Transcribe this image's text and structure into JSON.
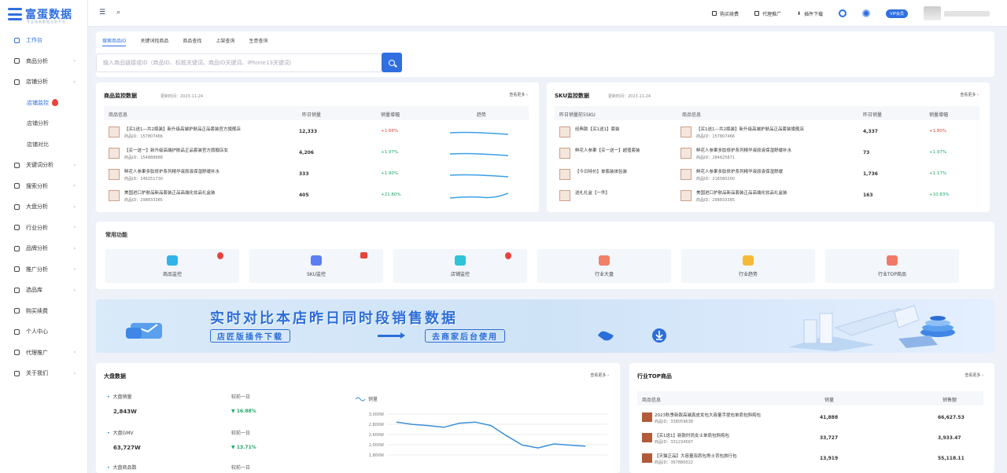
{
  "brand": {
    "name": "富蛋数据",
    "sub": "专业电商数据分析平台"
  },
  "sidebar": {
    "items": [
      {
        "label": "工作台",
        "active": true,
        "sub": false
      },
      {
        "label": "商品分析",
        "sub": false,
        "arrow": true
      },
      {
        "label": "店铺分析",
        "sub": false,
        "arrow": true
      },
      {
        "label": "店铺监控",
        "sub": true,
        "active": true,
        "hot": true
      },
      {
        "label": "店铺分析",
        "sub": true
      },
      {
        "label": "店铺对比",
        "sub": true
      },
      {
        "label": "关键词分析",
        "sub": false,
        "arrow": true
      },
      {
        "label": "搜索分析",
        "sub": false,
        "arrow": true
      },
      {
        "label": "大盘分析",
        "sub": false,
        "arrow": true
      },
      {
        "label": "行业分析",
        "sub": false,
        "arrow": true
      },
      {
        "label": "品牌分析",
        "sub": false,
        "arrow": true
      },
      {
        "label": "推广分析",
        "sub": false,
        "arrow": true
      },
      {
        "label": "选品库",
        "sub": false,
        "arrow": true
      },
      {
        "label": "购买续费",
        "sub": false
      },
      {
        "label": "个人中心",
        "sub": false
      },
      {
        "label": "代理推广",
        "sub": false,
        "arrow": true
      },
      {
        "label": "关于我们",
        "sub": false,
        "arrow": true
      }
    ]
  },
  "topbar": {
    "links": [
      "购买续费",
      "代理推广",
      "插件下载"
    ],
    "vip": "VIP会员"
  },
  "search": {
    "tabs": [
      "搜索商品ID",
      "关键词找商品",
      "商品查找",
      "上架查询",
      "生意查询"
    ],
    "placeholder": "输入商品链接或ID（商品ID、标题关键词、商品ID关键词、iPhone13关键词）"
  },
  "goods_monitor": {
    "title": "商品监控数据",
    "meta": "更新时间：2023-11-24",
    "more": "查看更多 ›",
    "headers": [
      "商品信息",
      "昨日销量",
      "销量增幅",
      "趋势"
    ],
    "rows": [
      {
        "name": "【买1送1—共2瓶装】新升级高端护肤品正品套装官方旗舰店",
        "id": "商品ID：157807466",
        "sales": "12,333",
        "pct": "+1.66%",
        "trend": "up"
      },
      {
        "name": "【买一送一】新升级高端护肤品正品套装官方旗舰店女",
        "id": "商品ID：154888888",
        "sales": "4,206",
        "pct": "+1.07%",
        "trend": "down"
      },
      {
        "name": "鲜花人参果多肽修护系列精华液原液保湿舒缓补水",
        "id": "商品ID：148251730",
        "sales": "333",
        "pct": "+1.90%",
        "trend": "down"
      },
      {
        "name": "美国进口护肤品新品套装正品高端化妆品礼盒装",
        "id": "商品ID：298833385",
        "sales": "405",
        "pct": "+21.80%",
        "trend": "down"
      }
    ]
  },
  "sku_monitor": {
    "title": "SKU监控数据",
    "meta": "更新时间：2023-11-24",
    "more": "查看更多 ›",
    "headers": [
      "昨日销量前5SKU",
      "商品信息",
      "昨日销量",
      "销量增幅"
    ],
    "rows": [
      {
        "sku": "经典款【买1送1】套装",
        "name": "【买1送1—共2瓶装】新升级高端护肤品正品套装旗舰店",
        "id": "商品ID：157807466",
        "sales": "4,337",
        "pct": "+1.80%",
        "trend": "up"
      },
      {
        "sku": "鲜花人参果【买一送一】超值套装",
        "name": "鲜花人参果多肽修护系列精华液原液保湿舒缓补水",
        "id": "商品ID：284625871",
        "sales": "73",
        "pct": "+1.97%",
        "trend": "down"
      },
      {
        "sku": "【今日特价】单瓶装体验装",
        "name": "鲜花人参果多肽修护系列精华液原液保湿舒缓",
        "id": "商品ID：216580200",
        "sales": "1,736",
        "pct": "+1.17%",
        "trend": "down"
      },
      {
        "sku": "送礼礼盒【一件】",
        "name": "美国进口护肤品新品套装正品高端化妆品礼盒装",
        "id": "商品ID：298833385",
        "sales": "163",
        "pct": "+10.83%",
        "trend": "down"
      }
    ]
  },
  "functions": {
    "title": "常用功能",
    "items": [
      {
        "label": "商品监控",
        "color": "#33b4e8",
        "badge": "dot"
      },
      {
        "label": "SKU监控",
        "color": "#5b7ef0",
        "badge": "square"
      },
      {
        "label": "店铺监控",
        "color": "#2ec3d6",
        "badge": "dot"
      },
      {
        "label": "行业大盘",
        "color": "#f0806a",
        "badge": ""
      },
      {
        "label": "行业趋势",
        "color": "#f5b93a",
        "badge": ""
      },
      {
        "label": "行业TOP商品",
        "color": "#f07a6a",
        "badge": ""
      }
    ]
  },
  "banner": {
    "title": "实时对比本店昨日同时段销售数据",
    "box1": "店匠版插件下载",
    "box2": "去商家后台使用"
  },
  "market": {
    "title": "大盘数据",
    "more": "查看更多 ›",
    "legend": "销量",
    "stats": [
      {
        "label": "大盘销量",
        "cmp": "较前一日",
        "value": "2,843W",
        "pct": "▼ 16.88%"
      },
      {
        "label": "大盘GMV",
        "cmp": "较前一日",
        "value": "63,727W",
        "pct": "▼ 13.71%"
      },
      {
        "label": "大盘商品数",
        "cmp": "较前一日",
        "value": "",
        "pct": ""
      }
    ],
    "yticks": [
      "3,000W",
      "2,800W",
      "2,600W",
      "2,000W",
      "1,800W"
    ]
  },
  "chart_data": {
    "type": "line",
    "series": [
      {
        "name": "销量",
        "values": [
          2800,
          2760,
          2740,
          2710,
          2780,
          2800,
          2740,
          2560,
          2400,
          2350,
          2420,
          2400,
          2380
        ]
      }
    ],
    "yticks": [
      "3,000W",
      "2,800W",
      "2,600W",
      "2,000W",
      "1,800W"
    ],
    "ylim": [
      1800,
      3000
    ],
    "xlabel": "",
    "ylabel": ""
  },
  "top_goods": {
    "title": "行业TOP商品",
    "more": "查看更多 ›",
    "headers": [
      "商品信息",
      "销量",
      "销售额"
    ],
    "rows": [
      {
        "name": "2023秋季新款高端真皮女包大容量手提包单肩包斜挎包",
        "id": "商品ID：338059638",
        "sales": "41,888",
        "amount": "66,627.53"
      },
      {
        "name": "【买1送1】新款时尚女士单肩包斜挎包",
        "id": "商品ID：331234567",
        "sales": "33,727",
        "amount": "3,933.47"
      },
      {
        "name": "【天猫正品】大容量双肩包男士背包旅行包",
        "id": "商品ID：367880022",
        "sales": "13,919",
        "amount": "55,118.11"
      }
    ]
  }
}
